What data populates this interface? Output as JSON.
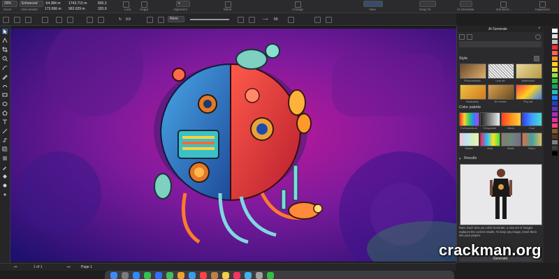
{
  "toolbar": {
    "zoom": "29%",
    "view_mode": "Enhanced",
    "zoom_label": "Zoom",
    "view_modes_label": "View Modes",
    "x_value": "-54.384 m",
    "y_value": "173.696 m",
    "w_value": "1743.715 m",
    "h_value": "963.029 m",
    "scale_w": "830.3",
    "scale_h": "320.9",
    "shear_label": "Share",
    "combine_label": "Combine",
    "lock_label": "Lock",
    "group_label": "Ungrp",
    "alignment_label": "Alignment",
    "mirror_label": "Mirror",
    "arrange_label": "Arrange",
    "view_label": "View",
    "snap_label": "Snap To",
    "ai_generate_label": "AI Generate",
    "get_more_label": "Get More...",
    "insp_label": "Inspectors"
  },
  "propbar": {
    "angle": "0.0",
    "fill_none": "None",
    "outline_width": "50"
  },
  "docker": {
    "title": "AI Generate",
    "style_heading": "Style",
    "styles": [
      {
        "label": "Photorealistic",
        "color": "#c8964a"
      },
      {
        "label": "Line art",
        "color": "#e8e8e8"
      },
      {
        "label": "Watercolor",
        "color": "#d8c27a"
      },
      {
        "label": "Illustration",
        "color": "#e7a63a"
      },
      {
        "label": "3D render",
        "color": "#b8863a"
      },
      {
        "label": "Pop art",
        "color": "#e0503a"
      }
    ],
    "palette_heading": "Color palette",
    "palettes": [
      {
        "label": "Full spectrum",
        "colors": [
          "#ff3030",
          "#ffd030",
          "#30d060",
          "#3080ff",
          "#b040ff"
        ]
      },
      {
        "label": "Grayscale",
        "colors": [
          "#222222",
          "#666666",
          "#aaaaaa",
          "#eeeeee"
        ]
      },
      {
        "label": "Warm",
        "colors": [
          "#ff4020",
          "#ff9020",
          "#ffd040"
        ]
      },
      {
        "label": "Cool",
        "colors": [
          "#3040ff",
          "#40a0ff",
          "#40e0d0"
        ]
      },
      {
        "label": "Pastel",
        "colors": [
          "#f8c0d0",
          "#c0e0f8",
          "#d0f0c0",
          "#f8e8b0"
        ]
      },
      {
        "label": "Vivid",
        "colors": [
          "#ff2060",
          "#20c0ff",
          "#ffe020",
          "#40e040"
        ]
      },
      {
        "label": "Matte",
        "colors": [
          "#8a7a6a",
          "#6a8a7a",
          "#7a6a8a"
        ]
      },
      {
        "label": "Retro",
        "colors": [
          "#e07040",
          "#40a0a0",
          "#e0c060"
        ]
      }
    ],
    "results_heading": "Results",
    "note": "Note: Each time you click Generate, a new set of images replaces the current results. To keep any image, insert them into your project.",
    "images_label": "Images",
    "generate_button": "Generate"
  },
  "bottom": {
    "page_nav": "1 of 1",
    "page_tab": "Page 1"
  },
  "watermark": "crackman.org"
}
